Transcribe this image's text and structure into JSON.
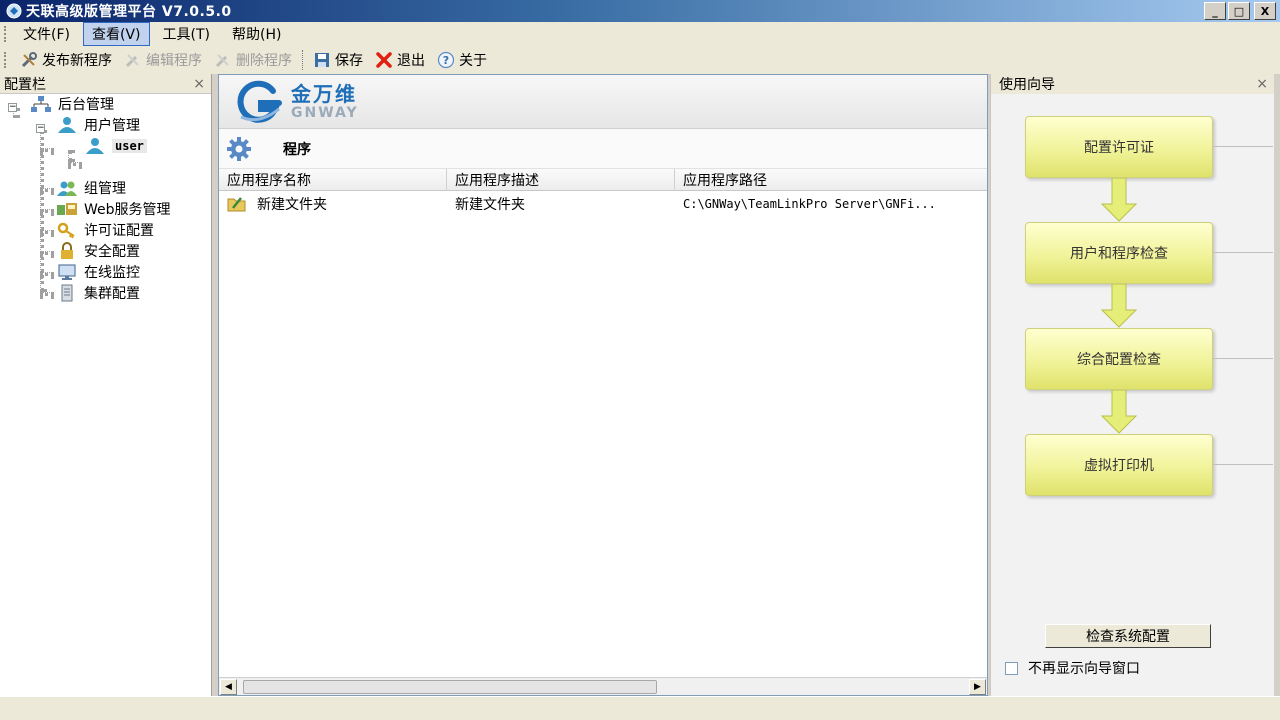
{
  "window": {
    "title": "天联高级版管理平台 V7.0.5.0",
    "controls": {
      "minimize": "_",
      "maximize": "□",
      "close": "X"
    }
  },
  "menubar": {
    "items": [
      {
        "label": "文件(F)",
        "active": false
      },
      {
        "label": "查看(V)",
        "active": true
      },
      {
        "label": "工具(T)",
        "active": false
      },
      {
        "label": "帮助(H)",
        "active": false
      }
    ]
  },
  "toolbar": {
    "publish_label": "发布新程序",
    "edit_label": "编辑程序",
    "delete_label": "删除程序",
    "save_label": "保存",
    "exit_label": "退出",
    "about_label": "关于"
  },
  "leftpanel": {
    "title": "配置栏",
    "close": "×",
    "tree": {
      "root": "后台管理",
      "user_mgmt": "用户管理",
      "user": "user",
      "group_mgmt": "组管理",
      "web_mgmt": "Web服务管理",
      "license": "许可证配置",
      "security": "安全配置",
      "monitor": "在线监控",
      "cluster": "集群配置"
    }
  },
  "center": {
    "logo_cn": "金万维",
    "logo_en": "GNWAY",
    "section_title": "程序",
    "columns": [
      "应用程序名称",
      "应用程序描述",
      "应用程序路径"
    ],
    "rows": [
      {
        "name": "新建文件夹",
        "desc": "新建文件夹",
        "path": "C:\\GNWay\\TeamLinkPro Server\\GNFi..."
      }
    ]
  },
  "wizard": {
    "title": "使用向导",
    "close": "×",
    "steps": [
      "配置许可证",
      "用户和程序检查",
      "综合配置检查",
      "虚拟打印机"
    ],
    "check_button": "检查系统配置",
    "dont_show": "不再显示向导窗口"
  },
  "colors": {
    "title_gradient_start": "#0a246a",
    "accent": "#316ac5",
    "step_fill": "#f1f39a",
    "logo_blue": "#1f6fb8"
  }
}
